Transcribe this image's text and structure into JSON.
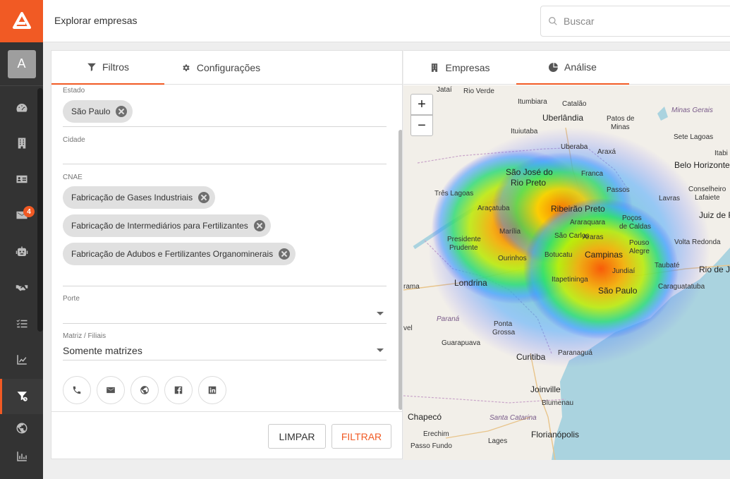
{
  "app": {
    "page_title": "Explorar empresas",
    "search_placeholder": "Buscar",
    "avatar_letter": "A",
    "brand_color": "#f15a24"
  },
  "sidebar": {
    "items": [
      {
        "icon": "dashboard-icon"
      },
      {
        "icon": "building-icon"
      },
      {
        "icon": "contact-card-icon"
      },
      {
        "icon": "mail-icon",
        "badge": "4"
      },
      {
        "icon": "robot-icon"
      },
      {
        "icon": "handshake-icon"
      },
      {
        "icon": "task-list-icon"
      },
      {
        "icon": "trend-chart-icon"
      },
      {
        "icon": "filter-clock-icon",
        "active": true
      },
      {
        "icon": "globe-icon"
      },
      {
        "icon": "bar-chart-icon"
      }
    ]
  },
  "filters": {
    "tabs": [
      {
        "label": "Filtros",
        "icon": "filter-icon",
        "active": true
      },
      {
        "label": "Configurações",
        "icon": "gear-icon",
        "active": false
      }
    ],
    "estado": {
      "label": "Estado",
      "chips": [
        "São Paulo"
      ]
    },
    "cidade": {
      "label": "Cidade"
    },
    "cnae": {
      "label": "CNAE",
      "chips": [
        "Fabricação de Gases Industriais",
        "Fabricação de Intermediários para Fertilizantes",
        "Fabricação de Adubos e Fertilizantes Organominerais"
      ]
    },
    "porte": {
      "label": "Porte",
      "value": ""
    },
    "matriz": {
      "label": "Matriz / Filiais",
      "value": "Somente matrizes"
    },
    "social": [
      "phone-icon",
      "email-icon",
      "website-icon",
      "facebook-icon",
      "linkedin-icon"
    ],
    "buttons": {
      "clear": "LIMPAR",
      "filter": "FILTRAR"
    }
  },
  "results": {
    "tabs": [
      {
        "label": "Empresas",
        "icon": "building-icon",
        "active": false
      },
      {
        "label": "Análise",
        "icon": "pie-chart-icon",
        "active": true
      }
    ]
  },
  "map": {
    "zoom_in": "+",
    "zoom_out": "−",
    "labels": [
      "Jataí",
      "Rio Verde",
      "Itumbiara",
      "Catalão",
      "Uberlândia",
      "Patos de",
      "Minas",
      "Ituiutaba",
      "Minas Gerais",
      "Sete Lagoas",
      "Itabi",
      "Belo Horizonte",
      "Uberaba",
      "Araxá",
      "São José do",
      "Rio Preto",
      "Franca",
      "Três Lagoas",
      "Passos",
      "Conselheiro",
      "Lafaiete",
      "Lavras",
      "Juiz de F",
      "Araçatuba",
      "Ribeirão Preto",
      "Poços",
      "de Caldas",
      "Marília",
      "Araraquara",
      "São Carlos",
      "Araras",
      "Presidente",
      "Prudente",
      "Botucatu",
      "Campinas",
      "Pouso",
      "Alegre",
      "Volta Redonda",
      "Ourinhos",
      "Jundiaí",
      "Taubaté",
      "Rio de Ja",
      "Londrina",
      "rama",
      "Itapetininga",
      "São Paulo",
      "Caraguatatuba",
      "Paraná",
      "vel",
      "Ponta",
      "Grossa",
      "Guarapuava",
      "Paranaguá",
      "Curitiba",
      "Joinville",
      "Blumenau",
      "Chapecó",
      "Santa Catarina",
      "Erechim",
      "Lages",
      "Florianópolis",
      "Passo Fundo"
    ]
  }
}
